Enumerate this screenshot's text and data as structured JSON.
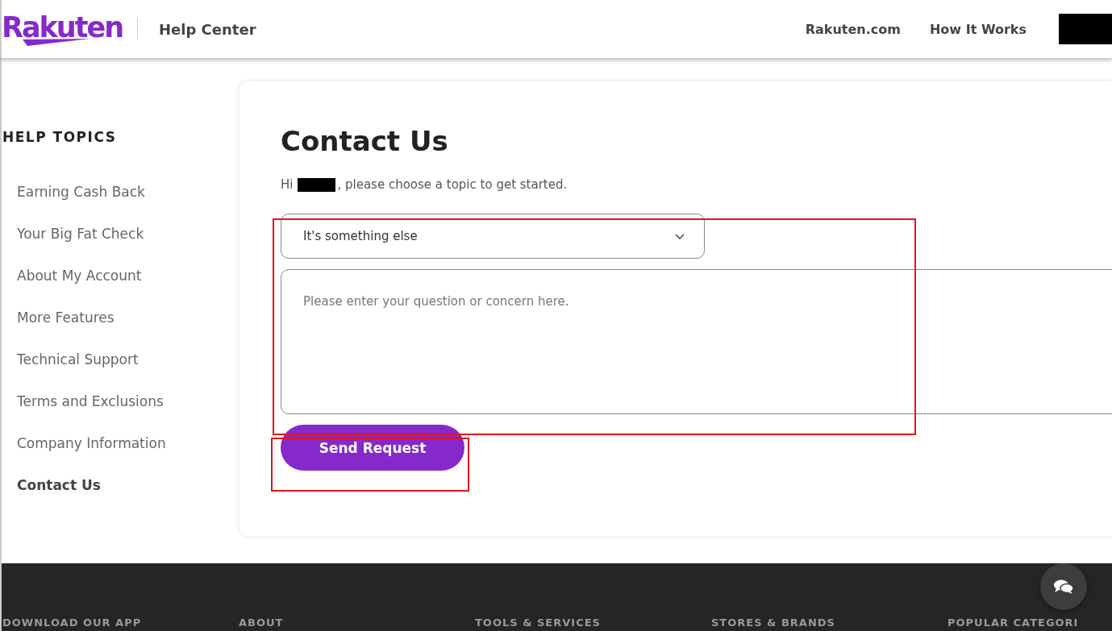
{
  "header": {
    "logo": "Rakuten",
    "section": "Help Center",
    "nav": [
      {
        "label": "Rakuten.com"
      },
      {
        "label": "How It Works"
      }
    ]
  },
  "sidebar": {
    "heading": "HELP TOPICS",
    "items": [
      {
        "label": "Earning Cash Back",
        "selected": false
      },
      {
        "label": "Your Big Fat Check",
        "selected": false
      },
      {
        "label": "About My Account",
        "selected": false
      },
      {
        "label": "More Features",
        "selected": false
      },
      {
        "label": "Technical Support",
        "selected": false
      },
      {
        "label": "Terms and Exclusions",
        "selected": false
      },
      {
        "label": "Company Information",
        "selected": false
      },
      {
        "label": "Contact Us",
        "selected": true
      }
    ]
  },
  "contact": {
    "title": "Contact Us",
    "greeting_start": "Hi",
    "greeting_end": ", please choose a topic to get started.",
    "topic": {
      "value": "It's something else"
    },
    "message": {
      "placeholder": "Please enter your question or concern here."
    },
    "submit": "Send Request"
  },
  "footer": {
    "headings": [
      "DOWNLOAD OUR APP",
      "ABOUT",
      "TOOLS & SERVICES",
      "STORES & BRANDS",
      "POPULAR CATEGORI"
    ]
  }
}
